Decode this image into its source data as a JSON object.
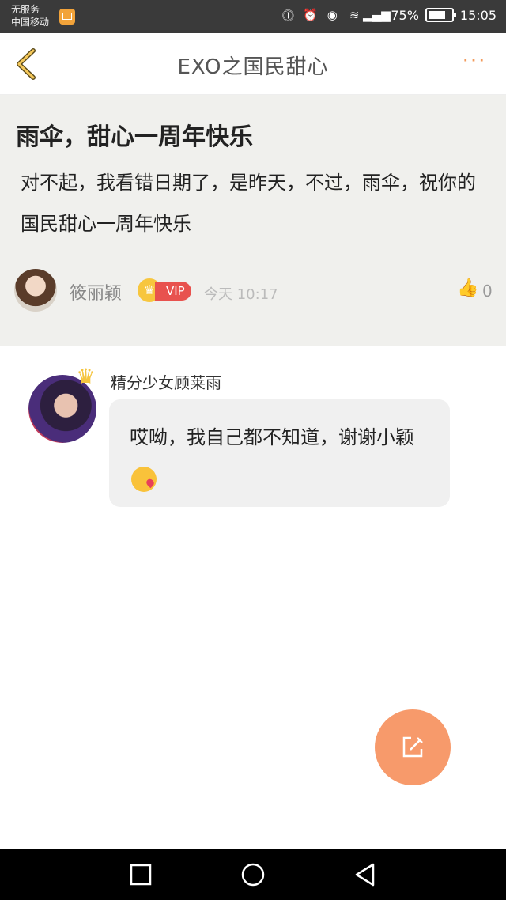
{
  "status_bar": {
    "carrier_line1": "无服务",
    "carrier_line2": "中国移动",
    "battery": "75%",
    "time": "15:05",
    "battery_level": 0.75
  },
  "header": {
    "title": "EXO之国民甜心",
    "back_icon": "back-chevron-icon",
    "more_icon": "more-dots-icon",
    "more_label": "···"
  },
  "post": {
    "title": "雨伞，甜心一周年快乐",
    "body": "对不起，我看错日期了，是昨天，不过，雨伞，祝你的国民甜心一周年快乐",
    "author": "筱丽颖",
    "vip_label": "VIP",
    "time": "今天 10:17",
    "likes": "0"
  },
  "reply": {
    "author": "精分少女顾莱雨",
    "text": "哎呦，我自己都不知道，谢谢小颖"
  },
  "colors": {
    "accent": "#f29a5b",
    "fab": "#f79a6b",
    "vip": "#e8524e",
    "post_bg": "#f0f0ed"
  }
}
